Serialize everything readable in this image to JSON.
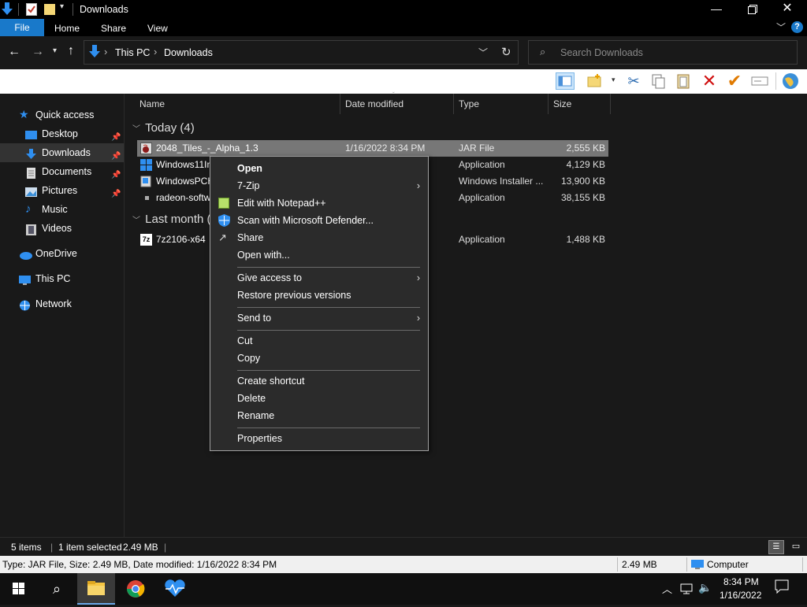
{
  "window": {
    "title": "Downloads"
  },
  "ribbon": {
    "tabs": [
      "File",
      "Home",
      "Share",
      "View"
    ]
  },
  "address": {
    "path": [
      "This PC",
      "Downloads"
    ]
  },
  "search": {
    "placeholder": "Search Downloads"
  },
  "nav": {
    "items": [
      {
        "label": "Quick access",
        "icon": "star-icon"
      },
      {
        "label": "Desktop",
        "icon": "desktop-icon",
        "pinned": true
      },
      {
        "label": "Downloads",
        "icon": "download-icon",
        "pinned": true,
        "selected": true
      },
      {
        "label": "Documents",
        "icon": "documents-icon",
        "pinned": true
      },
      {
        "label": "Pictures",
        "icon": "pictures-icon",
        "pinned": true
      },
      {
        "label": "Music",
        "icon": "music-icon"
      },
      {
        "label": "Videos",
        "icon": "videos-icon"
      },
      {
        "label": "OneDrive",
        "icon": "cloud-icon"
      },
      {
        "label": "This PC",
        "icon": "computer-icon"
      },
      {
        "label": "Network",
        "icon": "network-icon"
      }
    ]
  },
  "columns": {
    "name": "Name",
    "date": "Date modified",
    "type": "Type",
    "size": "Size"
  },
  "groups": {
    "today": "Today (4)",
    "last_month": "Last month (1)"
  },
  "files": [
    {
      "name": "2048_Tiles_-_Alpha_1.3",
      "date": "1/16/2022 8:34 PM",
      "type": "JAR File",
      "size": "2,555 KB"
    },
    {
      "name": "Windows11Installat",
      "date": "",
      "type": "Application",
      "size": "4,129 KB"
    },
    {
      "name": "WindowsPCHealthCh",
      "date": "",
      "type": "Windows Installer ...",
      "size": "13,900 KB"
    },
    {
      "name": "radeon-software-adr",
      "date": "",
      "type": "Application",
      "size": "38,155 KB"
    },
    {
      "name": "7z2106-x64",
      "date": "",
      "type": "Application",
      "size": "1,488 KB"
    }
  ],
  "context_menu": {
    "items": [
      "Open",
      "7-Zip",
      "Edit with Notepad++",
      "Scan with Microsoft Defender...",
      "Share",
      "Open with...",
      "Give access to",
      "Restore previous versions",
      "Send to",
      "Cut",
      "Copy",
      "Create shortcut",
      "Delete",
      "Rename",
      "Properties"
    ]
  },
  "status": {
    "items": "5 items",
    "selected": "1 item selected",
    "size": "2.49 MB"
  },
  "info": {
    "details": "Type: JAR File, Size: 2.49 MB, Date modified: 1/16/2022 8:34 PM",
    "size": "2.49 MB",
    "location": "Computer"
  },
  "taskbar": {
    "time": "8:34 PM",
    "date": "1/16/2022"
  },
  "colors": {
    "accent": "#1979ca",
    "selection": "#777777",
    "menu_bg": "#2b2b2b",
    "window_bg": "#191919"
  }
}
